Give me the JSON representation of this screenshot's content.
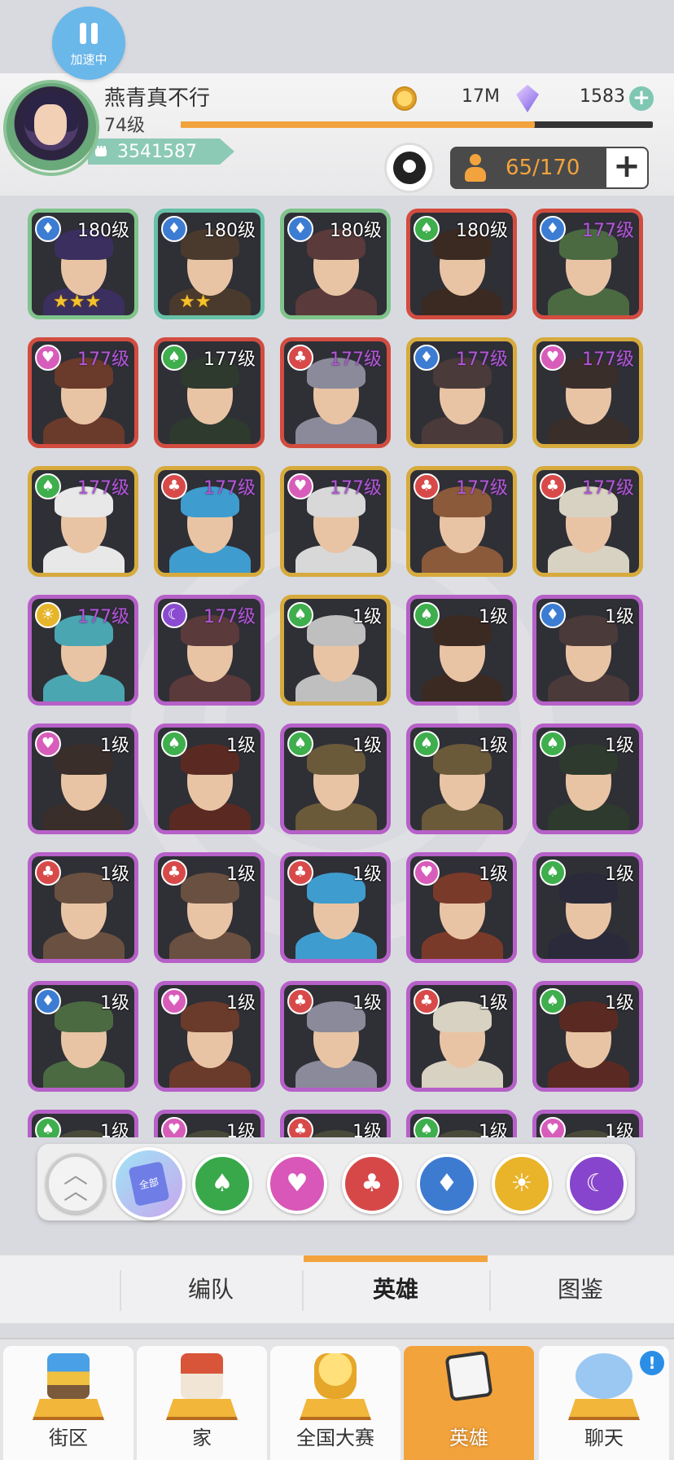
{
  "speed_badge": {
    "label": "加速中"
  },
  "player": {
    "name": "燕青真不行",
    "level": "74级",
    "xp_fraction": 0.75,
    "power": "3541587"
  },
  "currency": {
    "gold": "17M",
    "gems": "1583"
  },
  "roster": {
    "capacity": "65/170"
  },
  "heroes": [
    {
      "level": "180级",
      "faction": "blue",
      "rarity": "green",
      "stars": "★★★",
      "lvl_color": "white",
      "tone": "#3a2f5e"
    },
    {
      "level": "180级",
      "faction": "blue",
      "rarity": "teal",
      "stars": "★★",
      "lvl_color": "white",
      "tone": "#4a3a2e"
    },
    {
      "level": "180级",
      "faction": "blue",
      "rarity": "green",
      "stars": "",
      "lvl_color": "white",
      "tone": "#5a3a3a"
    },
    {
      "level": "180级",
      "faction": "green",
      "rarity": "red",
      "stars": "",
      "lvl_color": "white",
      "tone": "#3a2a22"
    },
    {
      "level": "177级",
      "faction": "blue",
      "rarity": "red",
      "stars": "",
      "lvl_color": "purple",
      "tone": "#4b6a42"
    },
    {
      "level": "177级",
      "faction": "pink",
      "rarity": "red",
      "stars": "",
      "lvl_color": "purple",
      "tone": "#6a3a2a"
    },
    {
      "level": "177级",
      "faction": "green",
      "rarity": "red",
      "stars": "",
      "lvl_color": "white",
      "tone": "#2e3a2e"
    },
    {
      "level": "177级",
      "faction": "red",
      "rarity": "red",
      "stars": "",
      "lvl_color": "purple",
      "tone": "#8a8a9a"
    },
    {
      "level": "177级",
      "faction": "blue",
      "rarity": "gold",
      "stars": "",
      "lvl_color": "purple",
      "tone": "#4a3a3a"
    },
    {
      "level": "177级",
      "faction": "pink",
      "rarity": "gold",
      "stars": "",
      "lvl_color": "purple",
      "tone": "#3a2e2a"
    },
    {
      "level": "177级",
      "faction": "green",
      "rarity": "gold",
      "stars": "",
      "lvl_color": "purple",
      "tone": "#e8e8e8"
    },
    {
      "level": "177级",
      "faction": "red",
      "rarity": "gold",
      "stars": "",
      "lvl_color": "purple",
      "tone": "#3f9ccf"
    },
    {
      "level": "177级",
      "faction": "pink",
      "rarity": "gold",
      "stars": "",
      "lvl_color": "purple",
      "tone": "#d8d8d8"
    },
    {
      "level": "177级",
      "faction": "red",
      "rarity": "gold",
      "stars": "",
      "lvl_color": "purple",
      "tone": "#8a5a3a"
    },
    {
      "level": "177级",
      "faction": "red",
      "rarity": "gold",
      "stars": "",
      "lvl_color": "purple",
      "tone": "#d8d2c2"
    },
    {
      "level": "177级",
      "faction": "sun",
      "rarity": "purple",
      "stars": "",
      "lvl_color": "purple",
      "tone": "#4aa6b0"
    },
    {
      "level": "177级",
      "faction": "moon",
      "rarity": "purple",
      "stars": "",
      "lvl_color": "purple",
      "tone": "#5a3a3a"
    },
    {
      "level": "1级",
      "faction": "green",
      "rarity": "gold",
      "stars": "",
      "lvl_color": "white",
      "tone": "#bfbfbf"
    },
    {
      "level": "1级",
      "faction": "green",
      "rarity": "purple",
      "stars": "",
      "lvl_color": "white",
      "tone": "#3a2a22"
    },
    {
      "level": "1级",
      "faction": "blue",
      "rarity": "purple",
      "stars": "",
      "lvl_color": "white",
      "tone": "#4a3a3a"
    },
    {
      "level": "1级",
      "faction": "pink",
      "rarity": "purple",
      "stars": "",
      "lvl_color": "white",
      "tone": "#3a2e2a"
    },
    {
      "level": "1级",
      "faction": "green",
      "rarity": "purple",
      "stars": "",
      "lvl_color": "white",
      "tone": "#5a2a22"
    },
    {
      "level": "1级",
      "faction": "green",
      "rarity": "purple",
      "stars": "",
      "lvl_color": "white",
      "tone": "#6a5a3a"
    },
    {
      "level": "1级",
      "faction": "green",
      "rarity": "purple",
      "stars": "",
      "lvl_color": "white",
      "tone": "#6a5a3a"
    },
    {
      "level": "1级",
      "faction": "green",
      "rarity": "purple",
      "stars": "",
      "lvl_color": "white",
      "tone": "#2e3a2e"
    },
    {
      "level": "1级",
      "faction": "red",
      "rarity": "purple",
      "stars": "",
      "lvl_color": "white",
      "tone": "#6a5040"
    },
    {
      "level": "1级",
      "faction": "red",
      "rarity": "purple",
      "stars": "",
      "lvl_color": "white",
      "tone": "#6a5040"
    },
    {
      "level": "1级",
      "faction": "red",
      "rarity": "purple",
      "stars": "",
      "lvl_color": "white",
      "tone": "#3f9ccf"
    },
    {
      "level": "1级",
      "faction": "pink",
      "rarity": "purple",
      "stars": "",
      "lvl_color": "white",
      "tone": "#7a3a2a"
    },
    {
      "level": "1级",
      "faction": "green",
      "rarity": "purple",
      "stars": "",
      "lvl_color": "white",
      "tone": "#2a2a3a"
    },
    {
      "level": "1级",
      "faction": "blue",
      "rarity": "purple",
      "stars": "",
      "lvl_color": "white",
      "tone": "#4b6a42"
    },
    {
      "level": "1级",
      "faction": "pink",
      "rarity": "purple",
      "stars": "",
      "lvl_color": "white",
      "tone": "#6a3a2a"
    },
    {
      "level": "1级",
      "faction": "red",
      "rarity": "purple",
      "stars": "",
      "lvl_color": "white",
      "tone": "#8a8a9a"
    },
    {
      "level": "1级",
      "faction": "red",
      "rarity": "purple",
      "stars": "",
      "lvl_color": "white",
      "tone": "#d8d2c2"
    },
    {
      "level": "1级",
      "faction": "green",
      "rarity": "purple",
      "stars": "",
      "lvl_color": "white",
      "tone": "#5a2a22"
    },
    {
      "level": "1级",
      "faction": "green",
      "rarity": "purple",
      "stars": "",
      "lvl_color": "white",
      "tone": "#4a4a3a"
    },
    {
      "level": "1级",
      "faction": "pink",
      "rarity": "purple",
      "stars": "",
      "lvl_color": "white",
      "tone": "#4a4a3a"
    },
    {
      "level": "1级",
      "faction": "red",
      "rarity": "purple",
      "stars": "",
      "lvl_color": "white",
      "tone": "#4a4a3a"
    },
    {
      "level": "1级",
      "faction": "green",
      "rarity": "purple",
      "stars": "",
      "lvl_color": "white",
      "tone": "#4a4a3a"
    },
    {
      "level": "1级",
      "faction": "pink",
      "rarity": "purple",
      "stars": "",
      "lvl_color": "white",
      "tone": "#4a4a3a"
    }
  ],
  "filters": {
    "all_label": "全部",
    "factions": [
      "green",
      "pink",
      "red",
      "blue",
      "sun",
      "moon"
    ]
  },
  "sub_tabs": [
    {
      "label": "编队"
    },
    {
      "label": "英雄"
    },
    {
      "label": "图鉴"
    }
  ],
  "bottom_nav": [
    {
      "label": "街区"
    },
    {
      "label": "家"
    },
    {
      "label": "全国大赛"
    },
    {
      "label": "英雄"
    },
    {
      "label": "聊天"
    }
  ],
  "notification": {
    "chat_badge": "!"
  },
  "colors": {
    "accent": "#f3a33d",
    "faction_green": "#3fae4d",
    "faction_pink": "#d85dba",
    "faction_red": "#d84a4a",
    "faction_blue": "#3c7dd3",
    "faction_sun": "#e7b52b",
    "faction_moon": "#8a4bd0"
  }
}
